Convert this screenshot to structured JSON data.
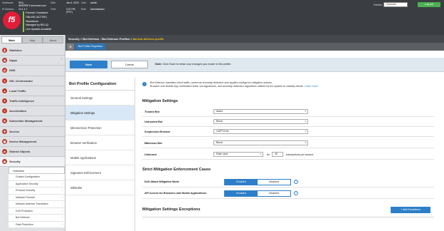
{
  "host": {
    "hostname_label": "Hostname",
    "hostname": "SEA-WEBPDF1.terminam.com",
    "ip_label": "IP Address",
    "ip": "10.1.1.7",
    "date_label": "Date",
    "date": "Jan 4, 2020",
    "time_label": "Time",
    "time": "3:07 PM (PST)",
    "user_label": "User",
    "user": "admin",
    "role_label": "Role",
    "role": "Administrator"
  },
  "logo": "f5",
  "status_lines": [
    "Firewall: Consistent",
    "ONLINE (ACTIVE)",
    "Standalone",
    "Managed by BIG-IQ",
    "Live Updates Available"
  ],
  "partition": {
    "label": "Partition",
    "value": "Common"
  },
  "logout_label": "Log out",
  "sidebar": {
    "tabs": [
      "Main",
      "Help",
      "About"
    ],
    "items": [
      {
        "label": "Statistics",
        "icon": "chart-icon"
      },
      {
        "label": "iApps",
        "icon": "apps-icon"
      },
      {
        "label": "DNS",
        "icon": "globe-icon"
      },
      {
        "label": "SSL Orchestrator",
        "icon": "lock-icon"
      },
      {
        "label": "Local Traffic",
        "icon": "traffic-icon"
      },
      {
        "label": "Traffic Intelligence",
        "icon": "intelligence-icon"
      },
      {
        "label": "Acceleration",
        "icon": "bolt-icon"
      },
      {
        "label": "Subscriber Management",
        "icon": "users-icon"
      },
      {
        "label": "Access",
        "icon": "key-icon"
      },
      {
        "label": "Device Management",
        "icon": "device-icon"
      },
      {
        "label": "Shared Objects",
        "icon": "objects-icon"
      },
      {
        "label": "Security",
        "icon": "shield-icon"
      }
    ],
    "security_sub": [
      "Overview",
      "Guided Configuration",
      "Application Security",
      "Protocol Security",
      "Network Firewall",
      "Network Address Translation",
      "DoS Protection",
      "Bot Defense",
      "Data Protection"
    ]
  },
  "breadcrumb": {
    "path": "Security » Bot Defense : Bot Defense Profiles » ",
    "current": "tab-bot-defense-profile"
  },
  "subtab": "Bot Profile Properties",
  "actions": {
    "save": "Save",
    "cancel": "Cancel",
    "note_bold": "Note:",
    "note": "Click Save to retain any changes you made in this profile."
  },
  "left_panel": {
    "title": "Bot Profile Configuration",
    "items": [
      "General Settings",
      "Mitigation Settings",
      "Microservice Protection",
      "Browser Verification",
      "Mobile Applications",
      "Signature Enforcement",
      "Whitelist"
    ],
    "active_index": 1
  },
  "info": {
    "line1": "Bot Defense classifies client traffic, performs anomaly detection and applies configured mitigation actions.",
    "line2": "Browser and Mobile App verification tests, bot signatures, and anomaly detection algorithms utilized by the system to classify clients.",
    "link": "Learn more"
  },
  "mitigation": {
    "title": "Mitigation Settings",
    "rows": [
      {
        "label": "Trusted Bot",
        "value": "Alarm"
      },
      {
        "label": "Untrusted Bot",
        "value": "Block"
      },
      {
        "label": "Suspicious Browser",
        "value": "CAPTCHA"
      },
      {
        "label": "Malicious Bot",
        "value": "Block"
      }
    ],
    "unknown": {
      "label": "Unknown",
      "value": "Rate Limit",
      "for": "for",
      "rate": "30",
      "unit": "transactions per second"
    }
  },
  "strict": {
    "title": "Strict Mitigation Enforcement Cases",
    "rows": [
      {
        "label": "DoS Attack Mitigation Mode",
        "on": "Enabled",
        "off": "Disabled"
      },
      {
        "label": "API Access for Browsers and Mobile Applications",
        "on": "Enabled",
        "off": "Disabled"
      }
    ]
  },
  "exceptions": {
    "title": "Mitigation Settings Exceptions",
    "add": "+ Add Exceptions"
  },
  "colors": {
    "accent": "#2c7fc8",
    "brand": "#e21d38",
    "header": "#3a3d42"
  }
}
